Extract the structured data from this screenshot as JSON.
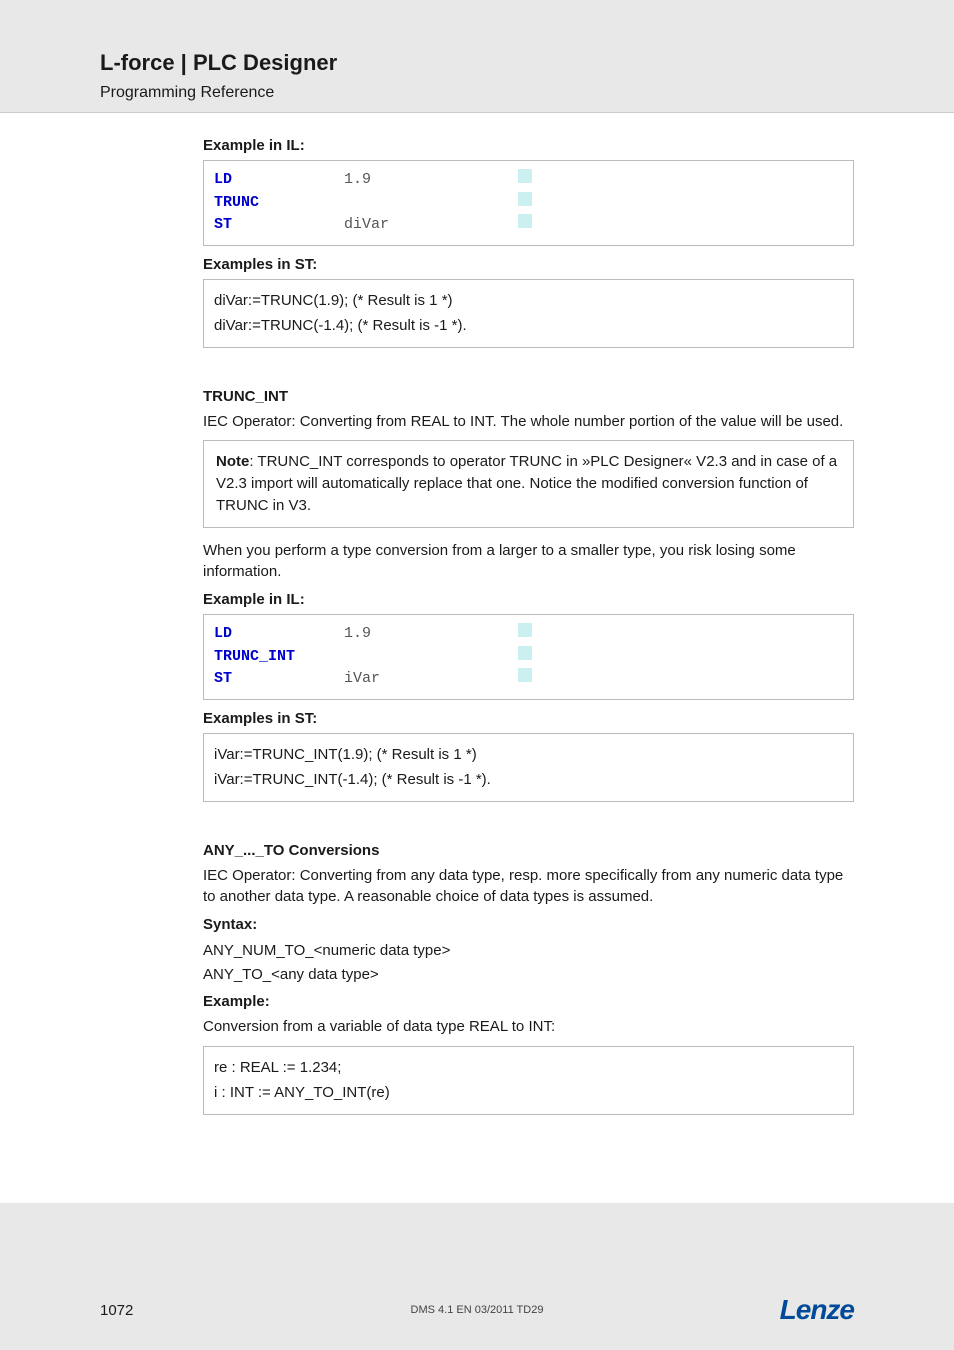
{
  "header": {
    "title": "L-force | PLC Designer",
    "subtitle": "Programming Reference"
  },
  "section1": {
    "example_il_label": "Example in IL:",
    "il_rows": [
      {
        "kw": "LD",
        "val": "1.9"
      },
      {
        "kw": "TRUNC",
        "val": ""
      },
      {
        "kw": "ST",
        "val": "diVar"
      }
    ],
    "examples_st_label": "Examples in ST:",
    "st_lines": [
      "diVar:=TRUNC(1.9); (* Result is 1 *)",
      "diVar:=TRUNC(-1.4); (* Result is -1 *)."
    ]
  },
  "trunc_int": {
    "heading": "TRUNC_INT",
    "desc": "IEC Operator: Converting from REAL to INT.  The whole number portion of the value will be used.",
    "note_label": "Note",
    "note_text": ": TRUNC_INT corresponds to operator TRUNC in »PLC Designer« V2.3 and in case of a V2.3 import will automatically replace that one. Notice the modified conversion function of TRUNC in V3.",
    "warning": "When you perform a type conversion from a larger to a smaller type, you risk losing some information.",
    "example_il_label": "Example in IL:",
    "il_rows": [
      {
        "kw": "LD",
        "val": "1.9"
      },
      {
        "kw": "TRUNC_INT",
        "val": ""
      },
      {
        "kw": "ST",
        "val": "iVar"
      }
    ],
    "examples_st_label": "Examples in ST:",
    "st_lines": [
      "iVar:=TRUNC_INT(1.9); (* Result is 1 *)",
      "iVar:=TRUNC_INT(-1.4); (* Result is -1 *)."
    ]
  },
  "any_to": {
    "heading": "ANY_..._TO Conversions",
    "desc": "IEC Operator: Converting from any data type, resp. more specifically from any numeric data type to another data type. A reasonable choice of data types is assumed.",
    "syntax_label": "Syntax:",
    "syntax_lines": [
      "ANY_NUM_TO_<numeric data type>",
      "ANY_TO_<any data type>"
    ],
    "example_label": "Example:",
    "example_desc": "Conversion from a variable of data type REAL to INT:",
    "example_code": [
      "re : REAL := 1.234;",
      "i : INT := ANY_TO_INT(re)"
    ]
  },
  "footer": {
    "page": "1072",
    "center": "DMS 4.1 EN 03/2011 TD29",
    "logo": "Lenze"
  }
}
